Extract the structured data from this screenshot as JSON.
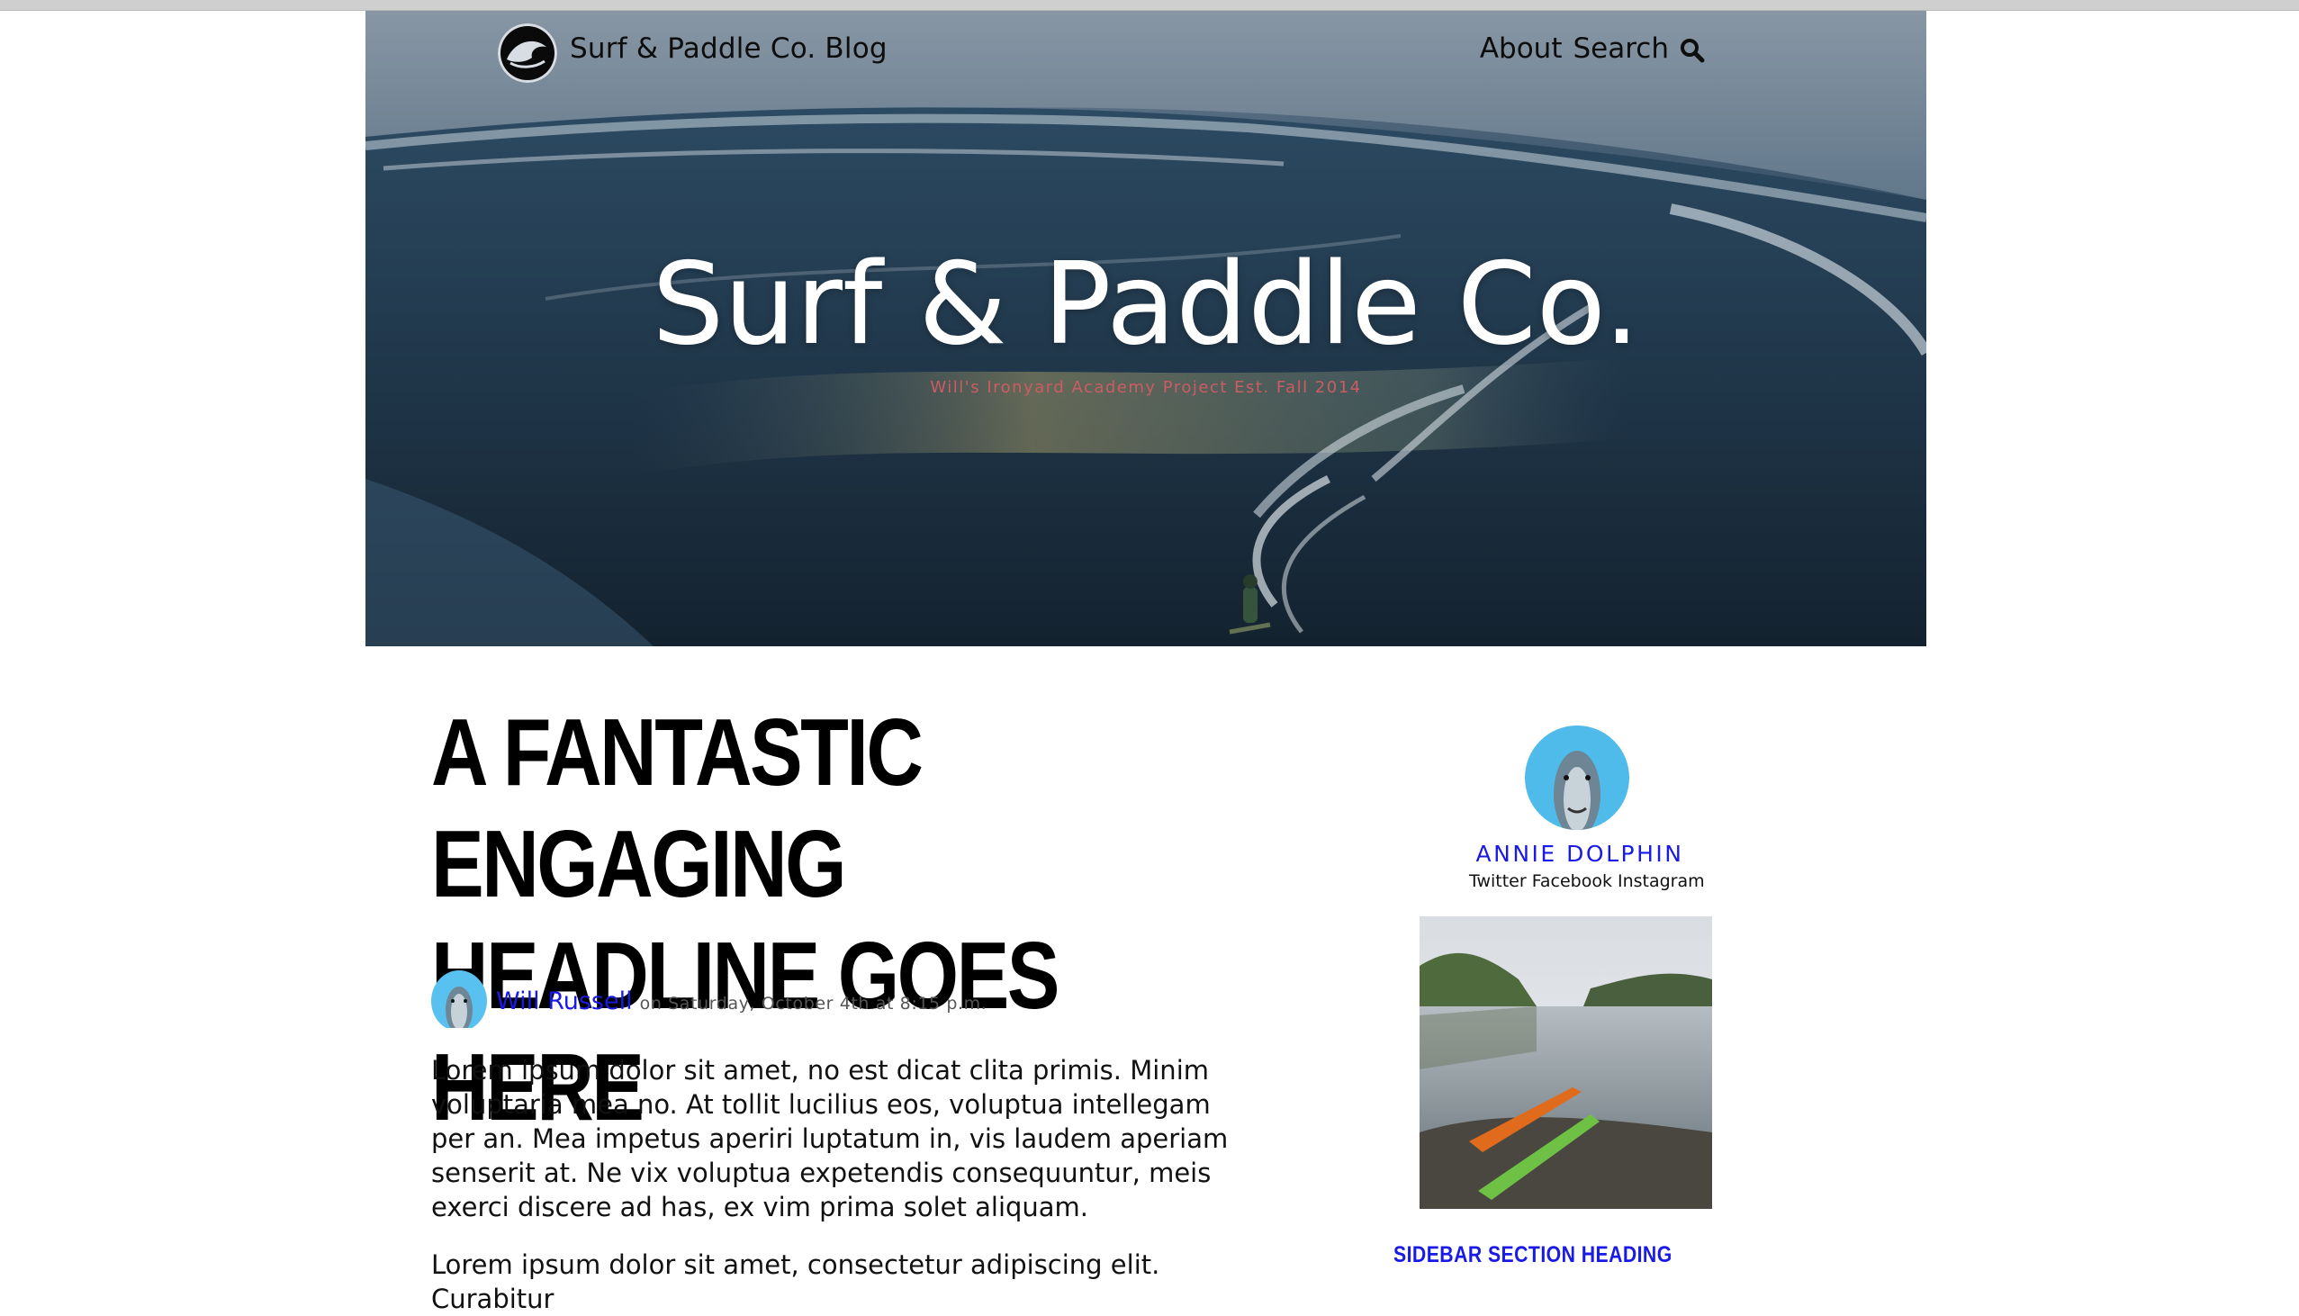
{
  "nav": {
    "brand": "Surf & Paddle Co. Blog",
    "about": "About",
    "search": "Search"
  },
  "hero": {
    "title": "Surf & Paddle Co.",
    "subtitle": "Will's Ironyard Academy Project Est. Fall 2014"
  },
  "post": {
    "headline_line1": "A FANTASTIC ENGAGING",
    "headline_line2": "HEADLINE GOES HERE",
    "author": "Will Russell",
    "date": "on Saturday, October 4th at 8:15 p.m.",
    "paragraph1": "Lorem ipsum dolor sit amet, no est dicat clita primis. Minim voluptaria mea no. At tollit lucilius eos, voluptua intellegam per an. Mea impetus aperiri luptatum in, vis laudem aperiam senserit at. Ne vix voluptua expetendis consequuntur, meis exerci discere ad has, ex vim prima solet aliquam.",
    "paragraph2": "Lorem ipsum dolor sit amet, consectetur adipiscing elit. Curabitur"
  },
  "sidebar": {
    "name": "ANNIE DOLPHIN",
    "social": [
      "Twitter",
      "Facebook",
      "Instagram"
    ],
    "section_heading": "SIDEBAR SECTION HEADING"
  },
  "colors": {
    "link_blue": "#1a1ae6",
    "subtitle_red": "#cc5c63"
  },
  "icons": [
    "logo-icon",
    "search-icon",
    "dolphin-avatar",
    "kayak-photo"
  ]
}
